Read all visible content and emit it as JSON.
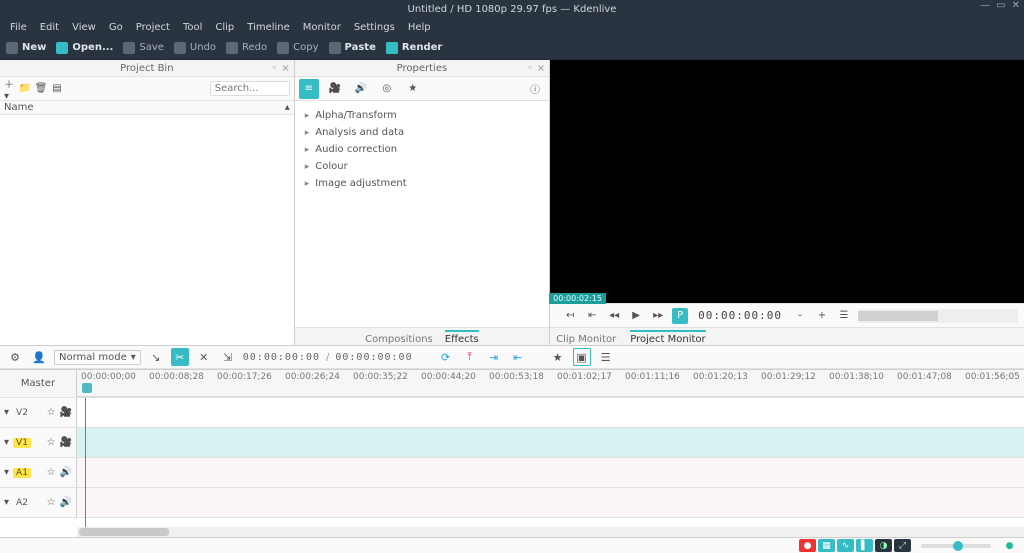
{
  "window_title": "Untitled / HD 1080p 29.97 fps — Kdenlive",
  "menus": [
    "File",
    "Edit",
    "View",
    "Go",
    "Project",
    "Tool",
    "Clip",
    "Timeline",
    "Monitor",
    "Settings",
    "Help"
  ],
  "toolbar": {
    "new": "New",
    "open": "Open...",
    "save": "Save",
    "undo": "Undo",
    "redo": "Redo",
    "copy": "Copy",
    "paste": "Paste",
    "render": "Render"
  },
  "project_bin": {
    "title": "Project Bin",
    "name_hdr": "Name",
    "search_placeholder": "Search..."
  },
  "properties": {
    "title": "Properties",
    "tabs": {
      "compositions": "Compositions",
      "effects": "Effects"
    }
  },
  "effects": [
    "Alpha/Transform",
    "Analysis and data",
    "Audio correction",
    "Colour",
    "Image adjustment"
  ],
  "monitor": {
    "marker": "00:00:02:15",
    "tc": "00:00:00:00",
    "tabs": {
      "clip": "Clip Monitor",
      "project": "Project Monitor"
    }
  },
  "timeline_toolbar": {
    "mode": "Normal mode",
    "tc_now": "00:00:00:00",
    "tc_dur": "00:00:00:00"
  },
  "master_label": "Master",
  "ruler": [
    "00:00:00;00",
    "00:00:08;28",
    "00:00:17;26",
    "00:00:26;24",
    "00:00:35;22",
    "00:00:44;20",
    "00:00:53;18",
    "00:01:02;17",
    "00:01:11;16",
    "00:01:20;13",
    "00:01:29;12",
    "00:01:38;10",
    "00:01:47;08",
    "00:01:56;05"
  ],
  "tracks": {
    "v2": "V2",
    "v1": "V1",
    "a1": "A1",
    "a2": "A2"
  }
}
